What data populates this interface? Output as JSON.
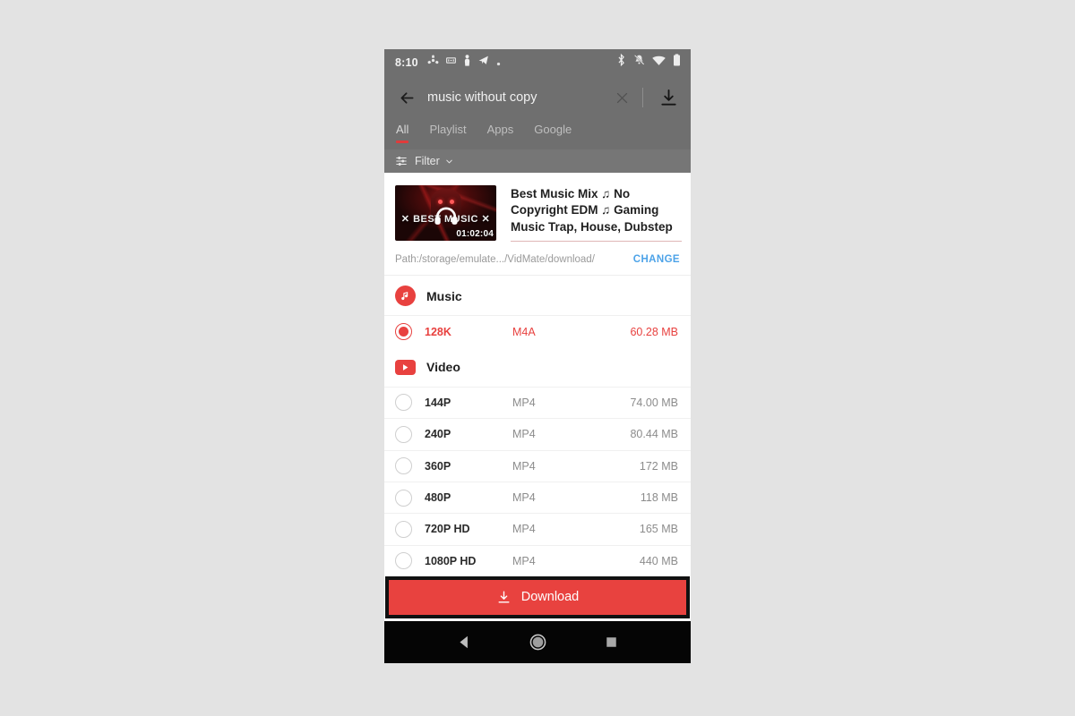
{
  "status_bar": {
    "time": "8:10",
    "left_icons": [
      "sync-icon",
      "hearing-aid-icon",
      "person-icon",
      "telegram-icon",
      "dot-icon"
    ],
    "right_icons": [
      "bluetooth-icon",
      "notifications-muted-icon",
      "wifi-icon",
      "battery-icon"
    ]
  },
  "toolbar": {
    "back_icon": "arrow-back-icon",
    "query": "music without copy",
    "clear_icon": "close-icon",
    "download_icon": "download-icon"
  },
  "tabs": {
    "items": [
      {
        "label": "All",
        "active": true
      },
      {
        "label": "Playlist",
        "active": false
      },
      {
        "label": "Apps",
        "active": false
      },
      {
        "label": "Google",
        "active": false
      }
    ]
  },
  "filter_bar": {
    "icon": "filter-sliders-icon",
    "label": "Filter",
    "chevron": "chevron-down-icon"
  },
  "video_card": {
    "title": "Best Music Mix ♫ No Copyright EDM ♫ Gaming Music Trap, House, Dubstep",
    "thumbnail": {
      "overlay_text": "✕ BEST MUSIC ✕",
      "duration": "01:02:04",
      "headphones_icon": "headphones-icon"
    }
  },
  "path_row": {
    "path": "Path:/storage/emulate.../VidMate/download/",
    "change_label": "CHANGE"
  },
  "sections": [
    {
      "id": "music",
      "icon": "music-note-icon",
      "title": "Music",
      "options": [
        {
          "quality": "128K",
          "format": "M4A",
          "size": "60.28 MB",
          "selected": true
        }
      ]
    },
    {
      "id": "video",
      "icon": "video-play-icon",
      "title": "Video",
      "options": [
        {
          "quality": "144P",
          "format": "MP4",
          "size": "74.00 MB",
          "selected": false
        },
        {
          "quality": "240P",
          "format": "MP4",
          "size": "80.44 MB",
          "selected": false
        },
        {
          "quality": "360P",
          "format": "MP4",
          "size": "172 MB",
          "selected": false
        },
        {
          "quality": "480P",
          "format": "MP4",
          "size": "118 MB",
          "selected": false
        },
        {
          "quality": "720P HD",
          "format": "MP4",
          "size": "165 MB",
          "selected": false
        },
        {
          "quality": "1080P HD",
          "format": "MP4",
          "size": "440 MB",
          "selected": false
        }
      ]
    }
  ],
  "download_button": {
    "label": "Download",
    "icon": "download-icon",
    "color": "#e8423f"
  },
  "nav_bar": {
    "back_icon": "nav-back-triangle-icon",
    "home_icon": "nav-home-circle-icon",
    "recents_icon": "nav-recents-square-icon"
  },
  "colors": {
    "accent_red": "#e8413f",
    "link_blue": "#4da3e8",
    "toolbar_gray": "#6f6f6f",
    "page_background": "#e3e3e3"
  }
}
